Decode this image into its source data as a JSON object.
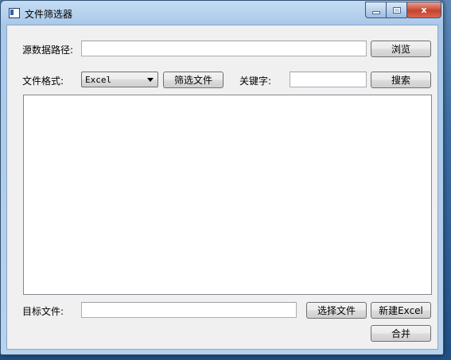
{
  "window": {
    "title": "文件筛选器",
    "controls": {
      "minimize": "",
      "maximize": "",
      "close": "x"
    }
  },
  "source": {
    "label": "源数据路径:",
    "value": "",
    "browse_label": "浏览"
  },
  "filter": {
    "format_label": "文件格式:",
    "format_selected": "Excel",
    "filter_button": "筛选文件",
    "keyword_label": "关键字:",
    "keyword_value": "",
    "search_button": "搜索"
  },
  "file_list": {
    "items": []
  },
  "target": {
    "label": "目标文件:",
    "value": "",
    "choose_button": "选择文件",
    "new_excel_button": "新建Excel",
    "merge_button": "合并"
  }
}
